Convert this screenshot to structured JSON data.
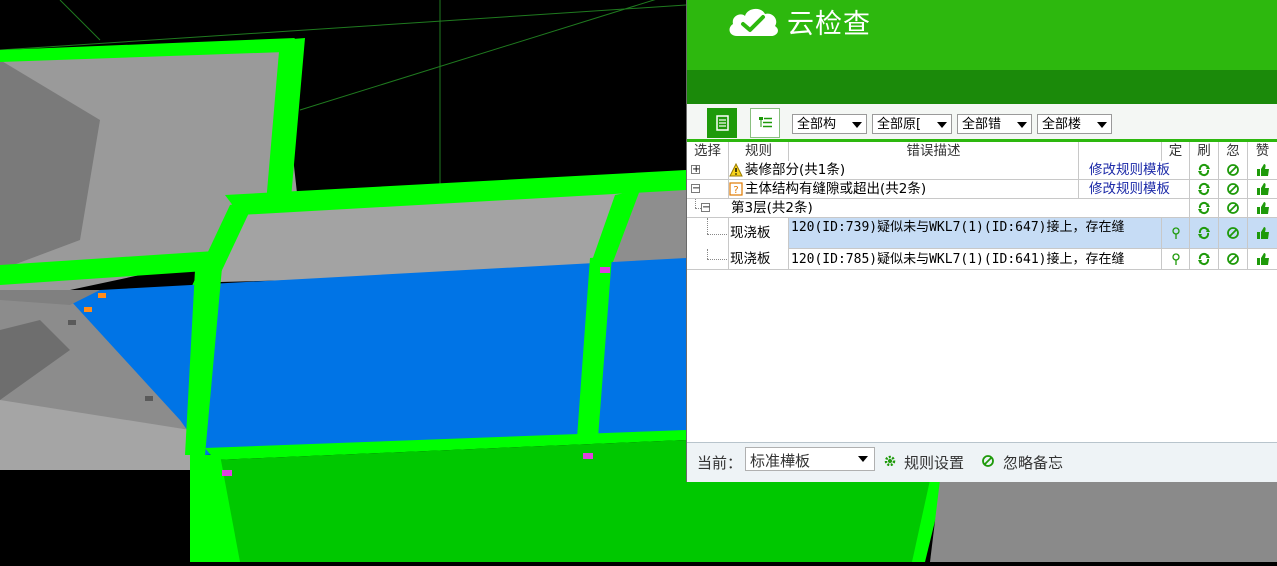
{
  "app": {
    "title": "云检查"
  },
  "toolbar": {
    "dropdowns": [
      "全部构",
      "全部原[",
      "全部错",
      "全部楼"
    ]
  },
  "table": {
    "headers": [
      "选择",
      "规则",
      "错误描述",
      "定",
      "刷",
      "忽",
      "赞"
    ],
    "groups": [
      {
        "label": "装修部分(共1条)",
        "icon": "warning-icon",
        "action": "修改规则模板"
      },
      {
        "label": "主体结构有缝隙或超出(共2条)",
        "icon": "question-icon",
        "action": "修改规则模板"
      }
    ],
    "floor": {
      "label": "第3层(共2条)"
    },
    "rows": [
      {
        "rule": "现浇板",
        "desc": "120(ID:739)疑似未与WKL7(1)(ID:647)接上，存在缝",
        "selected": true
      },
      {
        "rule": "现浇板",
        "desc": "120(ID:785)疑似未与WKL7(1)(ID:641)接上，存在缝",
        "selected": false
      }
    ]
  },
  "status": {
    "current_label": "当前：",
    "template_value": "标准樺板",
    "rule_settings": "规则设置",
    "ignore_notes": "忽略备忘"
  },
  "colors": {
    "panel_green": "#2db80e",
    "panel_dark_green": "#1b8a0a",
    "viewport_black": "#000000",
    "slab_blue": "#0074e6",
    "beam_green": "#00ff00",
    "selected_row": "#c6dcf5"
  }
}
